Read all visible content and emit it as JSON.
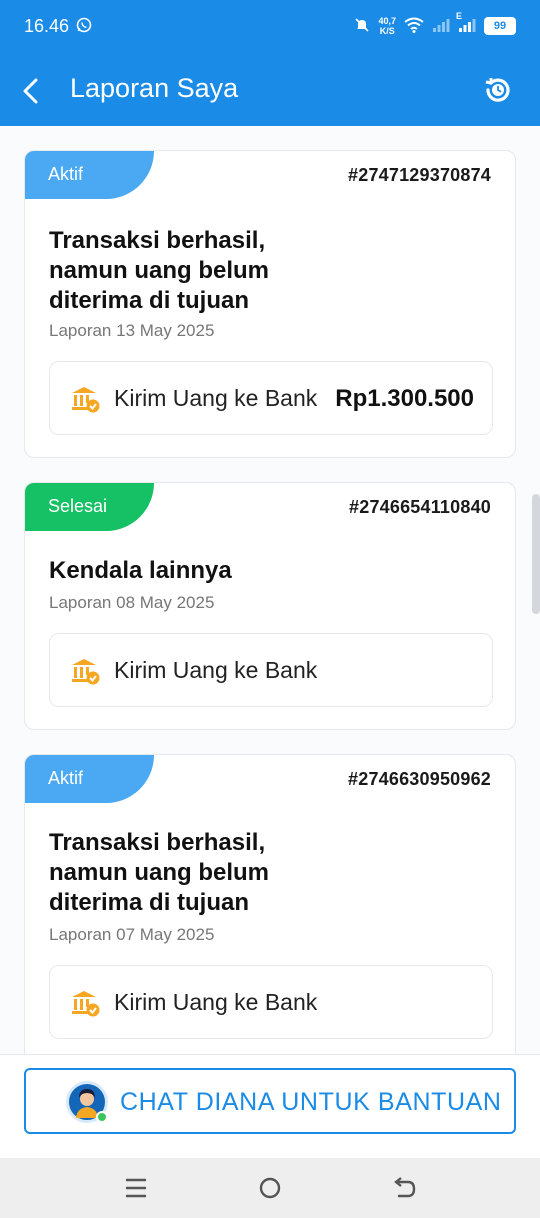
{
  "status_bar": {
    "time": "16.46",
    "speed_value": "40,7",
    "speed_unit": "K/S",
    "network": "E",
    "battery": "99"
  },
  "app_bar": {
    "title": "Laporan Saya",
    "icons": [
      "back-arrow-icon",
      "history-icon"
    ]
  },
  "reports": [
    {
      "status": "Aktif",
      "status_color": "#4aa9f2",
      "ticket": "#2747129370874",
      "issue_line1": "Transaksi berhasil,",
      "issue_line2": "namun uang belum",
      "issue_line3": "diterima di tujuan",
      "date": "Laporan 13 May 2025",
      "service": "Kirim Uang ke Bank",
      "amount": "Rp1.300.500"
    },
    {
      "status": "Selesai",
      "status_color": "#16c064",
      "ticket": "#2746654110840",
      "issue_line1": "Kendala lainnya",
      "date": "Laporan 08 May 2025",
      "service": "Kirim Uang ke Bank"
    },
    {
      "status": "Aktif",
      "status_color": "#4aa9f2",
      "ticket": "#2746630950962",
      "issue_line1": "Transaksi berhasil,",
      "issue_line2": "namun uang belum",
      "issue_line3": "diterima di tujuan",
      "date": "Laporan 07 May 2025",
      "service": "Kirim Uang ke Bank"
    }
  ],
  "chat_button": {
    "label": "CHAT DIANA UNTUK BANTUAN"
  },
  "colors": {
    "primary": "#1a8be6",
    "active": "#4aa9f2",
    "done": "#16c064",
    "bank_icon": "#f5a623"
  }
}
